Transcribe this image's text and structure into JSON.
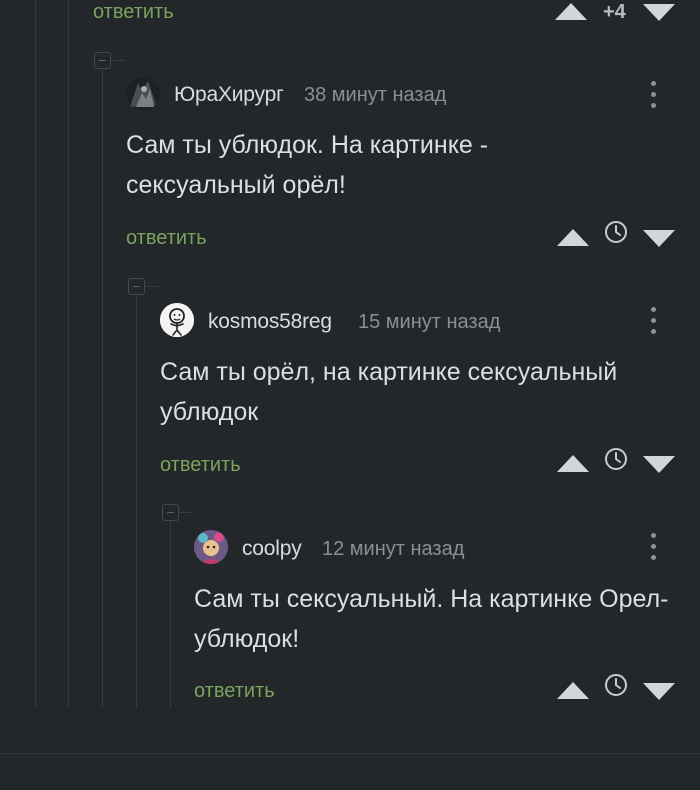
{
  "top": {
    "reply_label": "ответить",
    "rating": "+4"
  },
  "comments": [
    {
      "username": "ЮраХирург",
      "time": "38 минут назад",
      "text": "Сам ты ублюдок. На картинке - сексуальный орёл!",
      "reply_label": "ответить"
    },
    {
      "username": "kosmos58reg",
      "time": "15 минут назад",
      "text": "Сам ты орёл, на картинке сексуальный ублюдок",
      "reply_label": "ответить"
    },
    {
      "username": "coolpy",
      "time": "12 минут назад",
      "text": "Сам ты сексуальный. На картинке Орел-ублюдок!",
      "reply_label": "ответить"
    }
  ],
  "colors": {
    "background": "#24272a",
    "reply": "#7aa35d",
    "muted": "#8a8f94"
  }
}
